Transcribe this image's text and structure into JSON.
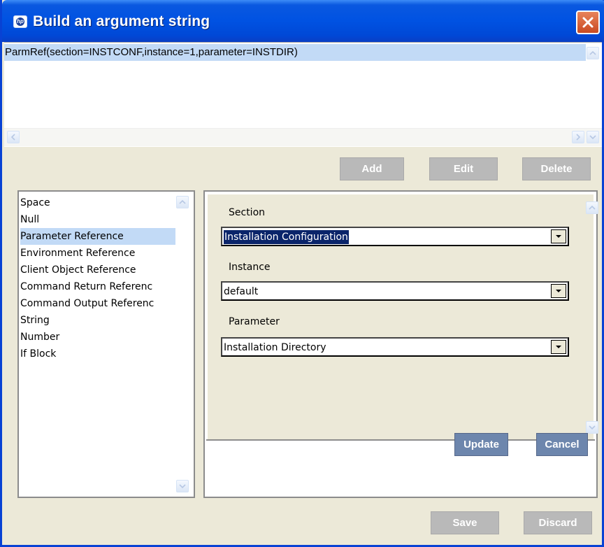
{
  "window": {
    "title": "Build an argument string"
  },
  "argument": {
    "text": "ParmRef(section=INSTCONF,instance=1,parameter=INSTDIR)"
  },
  "arg_buttons": {
    "add": "Add",
    "edit": "Edit",
    "delete": "Delete"
  },
  "types_list": {
    "items": [
      "Space",
      "Null",
      "Parameter Reference",
      "Environment Reference",
      "Client Object Reference",
      "Command Return Referenc",
      "Command Output Referenc",
      "String",
      "Number",
      "If Block"
    ],
    "selected": "Parameter Reference"
  },
  "form": {
    "section_label": "Section",
    "section_value": "Installation Configuration",
    "instance_label": "Instance",
    "instance_value": "default",
    "parameter_label": "Parameter",
    "parameter_value": "Installation Directory"
  },
  "form_buttons": {
    "update": "Update",
    "cancel": "Cancel"
  },
  "footer_buttons": {
    "save": "Save",
    "discard": "Discard"
  },
  "colors": {
    "titlebar": "#0052e2",
    "selection": "#c2daf6",
    "active_button": "#6d86ad",
    "disabled_button": "#b9b9b9"
  }
}
